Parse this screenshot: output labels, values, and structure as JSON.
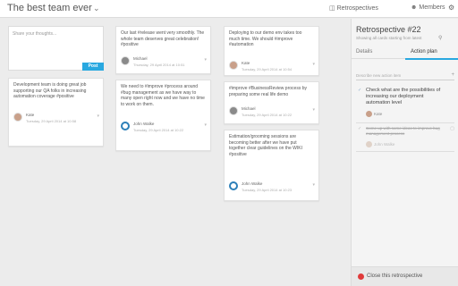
{
  "header": {
    "team_title": "The best team ever",
    "nav_retrospectives": "Retrospectives",
    "nav_members": "Members"
  },
  "compose": {
    "placeholder": "Share your thoughts...",
    "post_label": "Post"
  },
  "columns": {
    "col1": [
      {
        "text": "Development team is doing great job supporting our QA folks in increasing automation coverage #positive",
        "author": "Kate",
        "date": "Tuesday, 29 April 2014 at 10:58"
      }
    ],
    "col2": [
      {
        "text": "Our last #release went very smoothly. The whole team deserves great celebration! #positive",
        "author": "Michael",
        "date": "Thursday, 29 April 2014 at 10:51"
      },
      {
        "text": "We need to #improve #process around #bug management as we have way to many open right now and we have no time to work on them.",
        "author": "John Walke",
        "date": "Tuesday, 29 April 2014 at 10:22"
      }
    ],
    "col3": [
      {
        "text": "Deploying to our demo env takes too much time. We should #improve #automation",
        "author": "Kate",
        "date": "Tuesday, 29 April 2014 at 10:54"
      },
      {
        "text": "#improve #BusinessReview process by preparing some real life demo",
        "author": "Michael",
        "date": "Tuesday, 29 April 2014 at 10:22"
      },
      {
        "text": "Estimation/grooming sessions are becoming better after we have put together clear guidelines on the WIKI #positive",
        "author": "John Walke",
        "date": "Tuesday, 29 April 2014 at 10:23"
      }
    ]
  },
  "sidebar": {
    "title": "Retrospective #22",
    "subtitle": "Showing all cards starting from latest",
    "tabs": [
      "Details",
      "Action plan"
    ],
    "active_tab": "Action plan",
    "new_action_placeholder": "Describe new action item",
    "actions": [
      {
        "text": "Check what are the possibilities of increasing our deployment automation level",
        "assignee": "Kate",
        "done": false
      },
      {
        "text": "Come up with some ideas to improve bug management process",
        "assignee": "John Walke",
        "done": true
      }
    ],
    "close_label": "Close this retrospective"
  },
  "colors": {
    "accent": "#29a8e0",
    "close_dot": "#e03b3b",
    "background": "#ececec"
  },
  "icons": {
    "chevron": "chevron-down-icon",
    "retrospectives": "folder-icon",
    "members": "user-icon",
    "settings": "gear-icon",
    "search": "search-icon",
    "add": "plus-icon",
    "check": "check-icon",
    "delete": "trash-icon"
  }
}
